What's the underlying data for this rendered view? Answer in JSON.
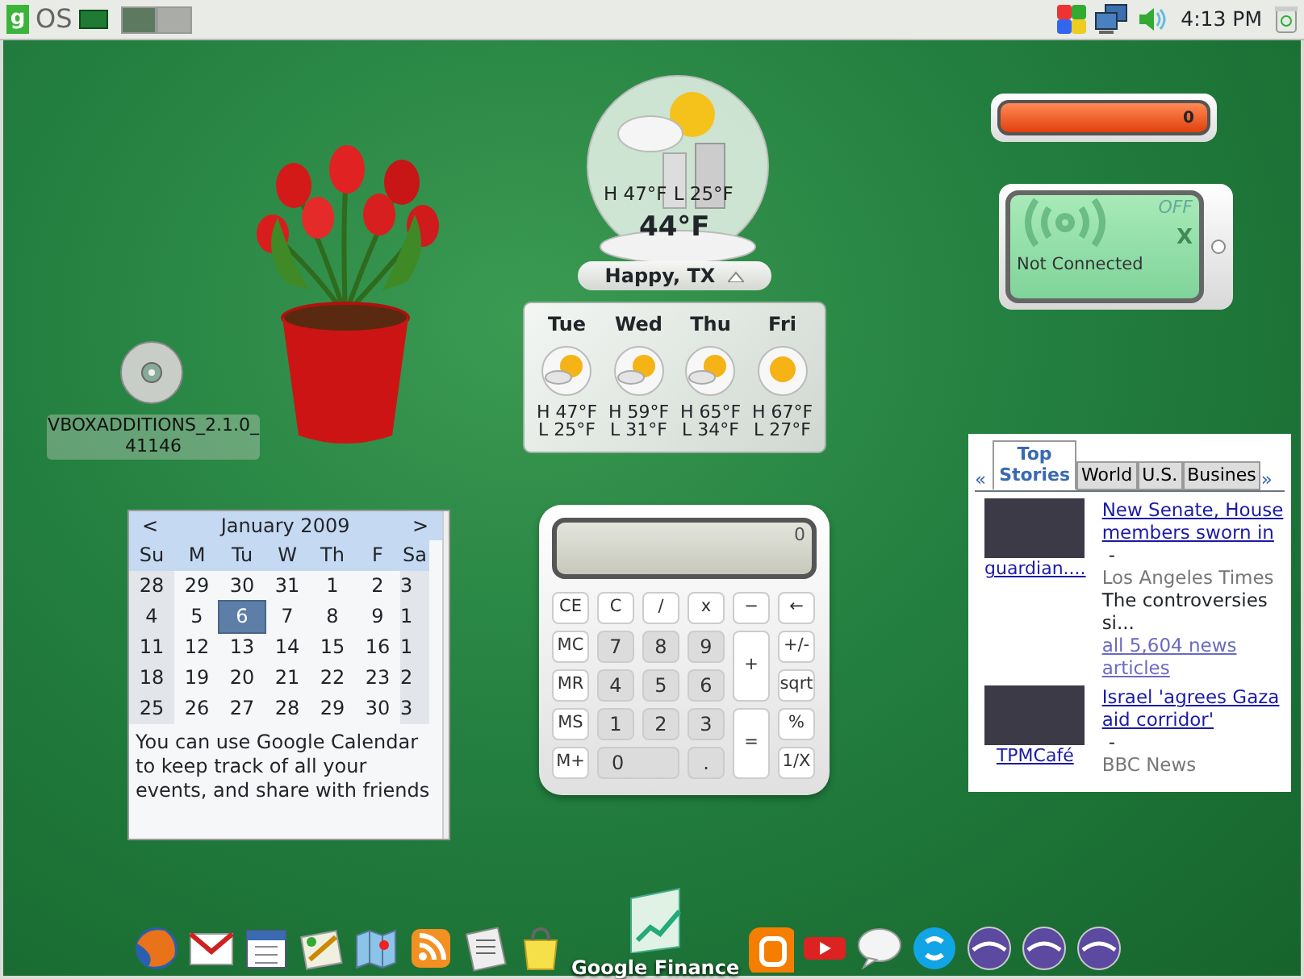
{
  "taskbar": {
    "logo_letter": "g",
    "logo_text": "OS",
    "workspaces": [
      {
        "selected": true
      },
      {
        "selected": false
      }
    ],
    "clock": "4:13 PM"
  },
  "desktop_icon": {
    "label": "VBOXADDITIONS_2.1.0_41146"
  },
  "weather": {
    "high": "H 47°F",
    "low": "L 25°F",
    "temperature": "44°F",
    "location": "Happy, TX",
    "expanded": true,
    "forecast": [
      {
        "day": "Tue",
        "kind": "partly-sunny",
        "high": "H 47°F",
        "low": "L 25°F"
      },
      {
        "day": "Wed",
        "kind": "partly-sunny",
        "high": "H 59°F",
        "low": "L 31°F"
      },
      {
        "day": "Thu",
        "kind": "partly-sunny",
        "high": "H 65°F",
        "low": "L 34°F"
      },
      {
        "day": "Fri",
        "kind": "sunny",
        "high": "H 67°F",
        "low": "L 27°F"
      }
    ]
  },
  "meter": {
    "reading": "0",
    "level": 0
  },
  "wifi": {
    "state": "OFF",
    "mark": "X",
    "status": "Not Connected"
  },
  "calendar": {
    "prev": "<",
    "month": "January 2009",
    "next": ">",
    "weekdays": [
      "Su",
      "M",
      "Tu",
      "W",
      "Th",
      "F",
      "Sa"
    ],
    "weeks": [
      [
        {
          "day": "28",
          "selected": false
        },
        {
          "day": "29",
          "selected": false
        },
        {
          "day": "30",
          "selected": false
        },
        {
          "day": "31",
          "selected": false
        },
        {
          "day": "1",
          "selected": false
        },
        {
          "day": "2",
          "selected": false
        },
        {
          "day": "3",
          "selected": false
        }
      ],
      [
        {
          "day": "4",
          "selected": false
        },
        {
          "day": "5",
          "selected": false
        },
        {
          "day": "6",
          "selected": true
        },
        {
          "day": "7",
          "selected": false
        },
        {
          "day": "8",
          "selected": false
        },
        {
          "day": "9",
          "selected": false
        },
        {
          "day": "1",
          "selected": false
        }
      ],
      [
        {
          "day": "11",
          "selected": false
        },
        {
          "day": "12",
          "selected": false
        },
        {
          "day": "13",
          "selected": false
        },
        {
          "day": "14",
          "selected": false
        },
        {
          "day": "15",
          "selected": false
        },
        {
          "day": "16",
          "selected": false
        },
        {
          "day": "1",
          "selected": false
        }
      ],
      [
        {
          "day": "18",
          "selected": false
        },
        {
          "day": "19",
          "selected": false
        },
        {
          "day": "20",
          "selected": false
        },
        {
          "day": "21",
          "selected": false
        },
        {
          "day": "22",
          "selected": false
        },
        {
          "day": "23",
          "selected": false
        },
        {
          "day": "2",
          "selected": false
        }
      ],
      [
        {
          "day": "25",
          "selected": false
        },
        {
          "day": "26",
          "selected": false
        },
        {
          "day": "27",
          "selected": false
        },
        {
          "day": "28",
          "selected": false
        },
        {
          "day": "29",
          "selected": false
        },
        {
          "day": "30",
          "selected": false
        },
        {
          "day": "3",
          "selected": false
        }
      ]
    ],
    "note": "You can use Google Calendar to keep track of all your events, and share with friends"
  },
  "calculator": {
    "display": "0",
    "keys": [
      {
        "label": "CE",
        "kind": "fn"
      },
      {
        "label": "C",
        "kind": "fn"
      },
      {
        "label": "/",
        "kind": "fn"
      },
      {
        "label": "x",
        "kind": "fn"
      },
      {
        "label": "−",
        "kind": "fn"
      },
      {
        "label": "←",
        "kind": "fn"
      },
      {
        "label": "MC",
        "kind": "fn"
      },
      {
        "label": "7",
        "kind": "digit"
      },
      {
        "label": "8",
        "kind": "digit"
      },
      {
        "label": "9",
        "kind": "digit"
      },
      {
        "label": "+",
        "kind": "tall"
      },
      {
        "label": "+/-",
        "kind": "fn"
      },
      {
        "label": "MR",
        "kind": "fn"
      },
      {
        "label": "4",
        "kind": "digit"
      },
      {
        "label": "5",
        "kind": "digit"
      },
      {
        "label": "6",
        "kind": "digit"
      },
      {
        "label": "sqrt",
        "kind": "fn"
      },
      {
        "label": "MS",
        "kind": "fn"
      },
      {
        "label": "1",
        "kind": "digit"
      },
      {
        "label": "2",
        "kind": "digit"
      },
      {
        "label": "3",
        "kind": "digit"
      },
      {
        "label": "=",
        "kind": "tall"
      },
      {
        "label": "%",
        "kind": "fn"
      },
      {
        "label": "M+",
        "kind": "fn"
      },
      {
        "label": "0",
        "kind": "wide"
      },
      {
        "label": ".",
        "kind": "digit"
      },
      {
        "label": "1/X",
        "kind": "fn"
      }
    ]
  },
  "news": {
    "prev": "«",
    "next": "»",
    "tabs": [
      {
        "label": "Top Stories",
        "selected": true
      },
      {
        "label": "World",
        "selected": false
      },
      {
        "label": "U.S.",
        "selected": false
      },
      {
        "label": "Busines",
        "selected": false
      }
    ],
    "stories": [
      {
        "source_link": "guardian....",
        "title": "New Senate, House members sworn in",
        "dash": "-",
        "source": "Los Angeles Times",
        "snippet": "The controversies si...",
        "more": "all 5,604 news articles"
      },
      {
        "source_link": "TPMCafé",
        "title": "Israel 'agrees Gaza aid corridor'",
        "dash": "-",
        "source": "BBC News"
      }
    ]
  },
  "dock": [
    {
      "kind": "browser"
    },
    {
      "kind": "mail"
    },
    {
      "kind": "calendar"
    },
    {
      "kind": "paint"
    },
    {
      "kind": "map"
    },
    {
      "kind": "feed"
    },
    {
      "kind": "reader"
    },
    {
      "kind": "bag"
    },
    {
      "kind": "chart",
      "label": "Google Finance"
    },
    {
      "kind": "blog"
    },
    {
      "kind": "video"
    },
    {
      "kind": "chat"
    },
    {
      "kind": "phone"
    },
    {
      "kind": "office"
    },
    {
      "kind": "office"
    },
    {
      "kind": "office"
    }
  ]
}
